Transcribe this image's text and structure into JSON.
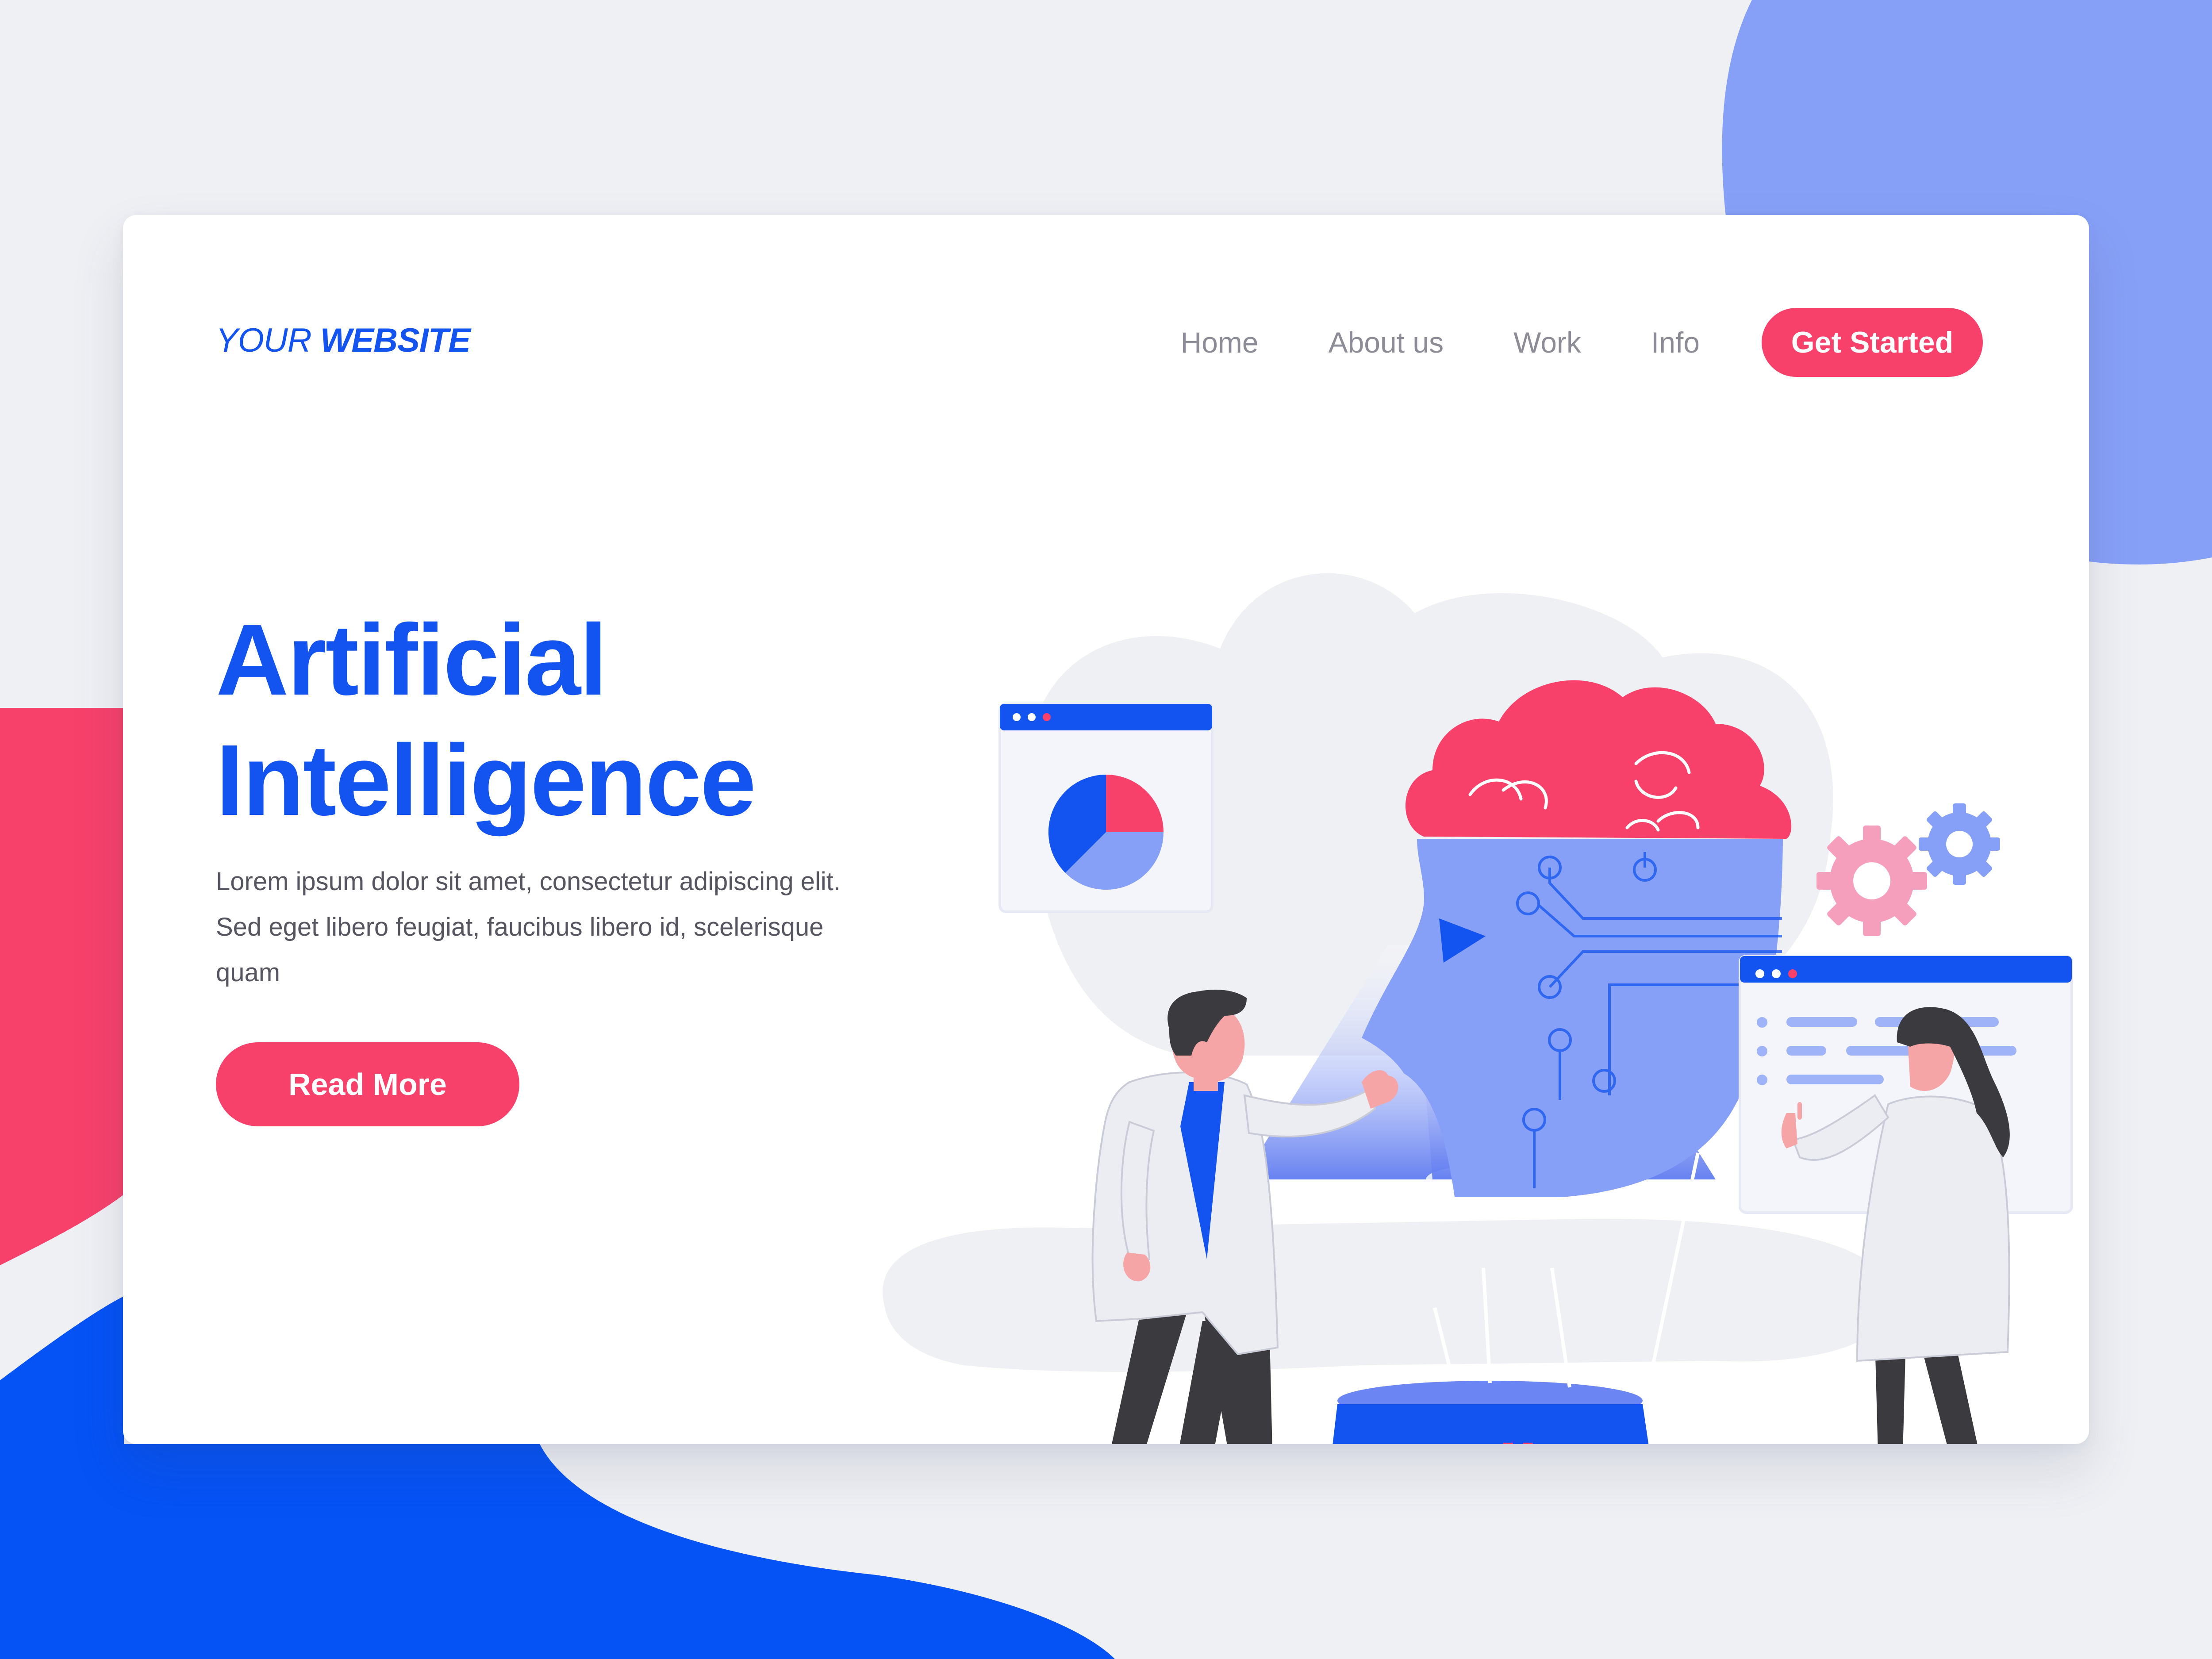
{
  "header": {
    "logo_part1": "YOUR ",
    "logo_part2": "WEBSITE",
    "nav": [
      {
        "label": "Home"
      },
      {
        "label": "About us"
      },
      {
        "label": "Work"
      },
      {
        "label": "Info"
      }
    ],
    "cta_label": "Get Started"
  },
  "hero": {
    "title_line1": "Artificial",
    "title_line2": "Intelligence",
    "description": "Lorem ipsum dolor sit amet, consectetur adipiscing elit. Sed eget libero feugiat, faucibus libero id, scelerisque quam",
    "button_label": "Read More"
  },
  "colors": {
    "brand_blue": "#1354f0",
    "accent_red": "#f7416b",
    "periwinkle": "#87a0f7",
    "page_bg": "#eff0f4",
    "text_gray": "#55555f",
    "nav_gray": "#8c8c96"
  },
  "illustration": {
    "icons": [
      "pie-chart-window-icon",
      "robot-head-icon",
      "brain-icon",
      "gear-icon",
      "gear-icon",
      "document-window-icon",
      "hologram-pedestal-icon",
      "scientist-man-icon",
      "scientist-woman-icon"
    ]
  }
}
